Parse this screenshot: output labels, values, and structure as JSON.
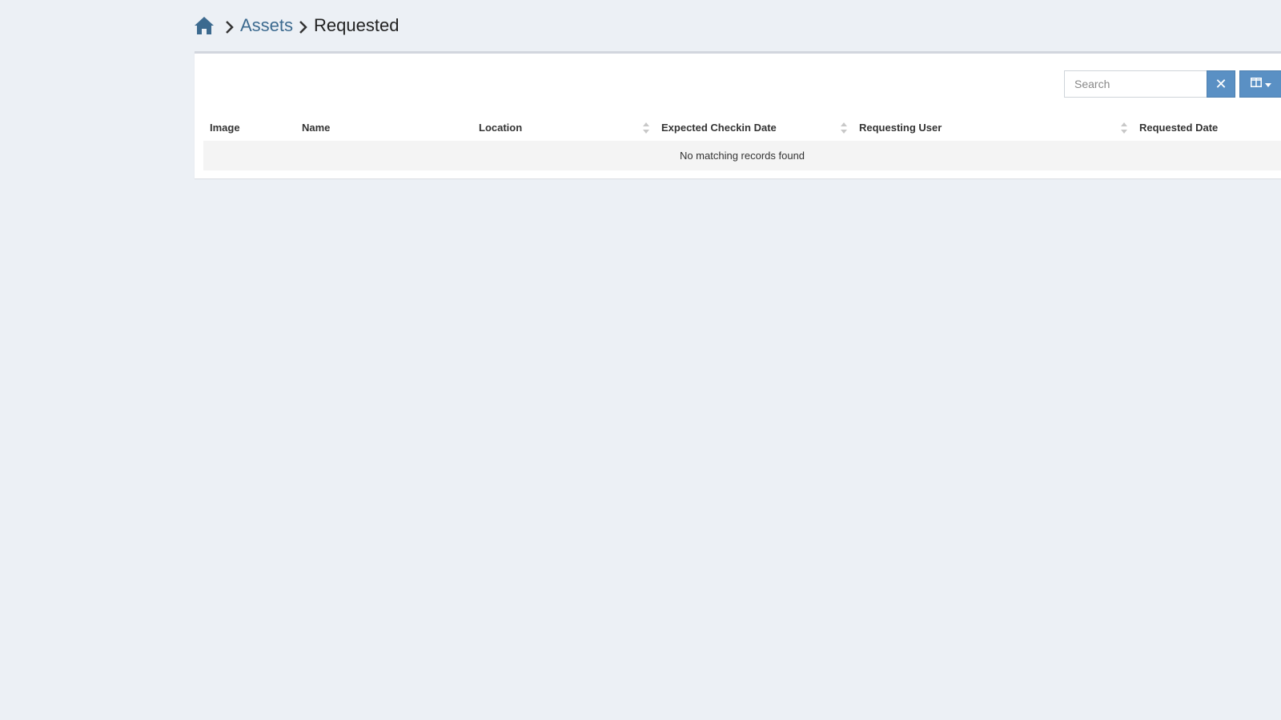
{
  "breadcrumb": {
    "home_icon": "home-icon",
    "items": [
      {
        "label": "Assets"
      },
      {
        "label": "Requested"
      }
    ]
  },
  "toolbar": {
    "search_placeholder": "Search",
    "clear_symbol": "✕",
    "columns_icon": "columns-icon"
  },
  "table": {
    "columns": [
      {
        "label": "Image",
        "sortable": false
      },
      {
        "label": "Name",
        "sortable": false
      },
      {
        "label": "Location",
        "sortable": true
      },
      {
        "label": "Expected Checkin Date",
        "sortable": true
      },
      {
        "label": "Requesting User",
        "sortable": true
      },
      {
        "label": "Requested Date",
        "sortable": false
      }
    ],
    "empty_message": "No matching records found"
  },
  "colors": {
    "background": "#ecf0f5",
    "link": "#3c6a8f",
    "button": "#5a90c4",
    "home_icon": "#3c6a8f"
  }
}
